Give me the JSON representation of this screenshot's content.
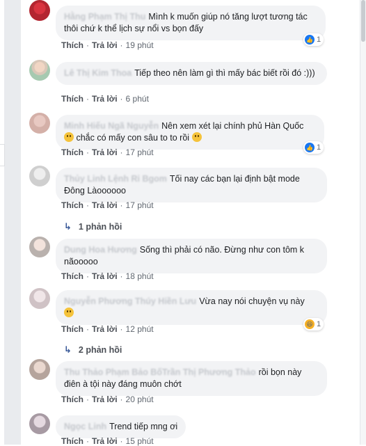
{
  "actions": {
    "like": "Thích",
    "reply": "Trả lời",
    "dot": "·"
  },
  "colors": {
    "like_blue": "#1877f2",
    "bubble": "#f2f3f5"
  },
  "comments": [
    {
      "author": "Hằng Phạm Thị Thu",
      "text": "Mình k muốn giúp nó tăng lượt tương tác thôi chứ k thể lịch sự nổi vs bọn đấy",
      "time": "19 phút",
      "reaction_icon": "like-icon",
      "reaction_count": "1"
    },
    {
      "author": "Lê Thị Kim Thoa",
      "text": "Tiếp theo nên làm gì thì mấy bác biết rồi đó :)))",
      "time": "6 phút"
    },
    {
      "author": "Minh Hiếu Ngã Nguyễn",
      "text": "Nên xem xét lại chính phủ Hàn Quốc",
      "text2": "chắc có mấy con sâu to to rồi",
      "time": "17 phút",
      "reaction_icon": "like-icon",
      "reaction_count": "1"
    },
    {
      "author": "Thủy Linh Lệnh Ri Bgom",
      "text": "Tối nay các bạn lại định bật mode Đông Làoooooo",
      "time": "17 phút",
      "replies": "1 phản hồi"
    },
    {
      "author": "Dung Hoa Hương",
      "text": "Sống thì phải có não. Đừng như con tôm k nãooooo",
      "time": "18 phút"
    },
    {
      "author": "Nguyễn Phương Thúy Hiền Lưu",
      "text": "Vừa nay nói chuyện vụ này",
      "time": "12 phút",
      "reaction_icon": "haha-icon",
      "reaction_count": "1",
      "replies": "2 phản hồi"
    },
    {
      "author": "Thu Thảo Phạm Bảo BốTrần Thị Phương Thảo",
      "text": "rồi bọn này điên à tội này đáng muôn chớt",
      "time": "20 phút"
    },
    {
      "author": "Ngọc Linh",
      "text": "Trend tiếp mng ơi",
      "time": "15 phút"
    }
  ]
}
